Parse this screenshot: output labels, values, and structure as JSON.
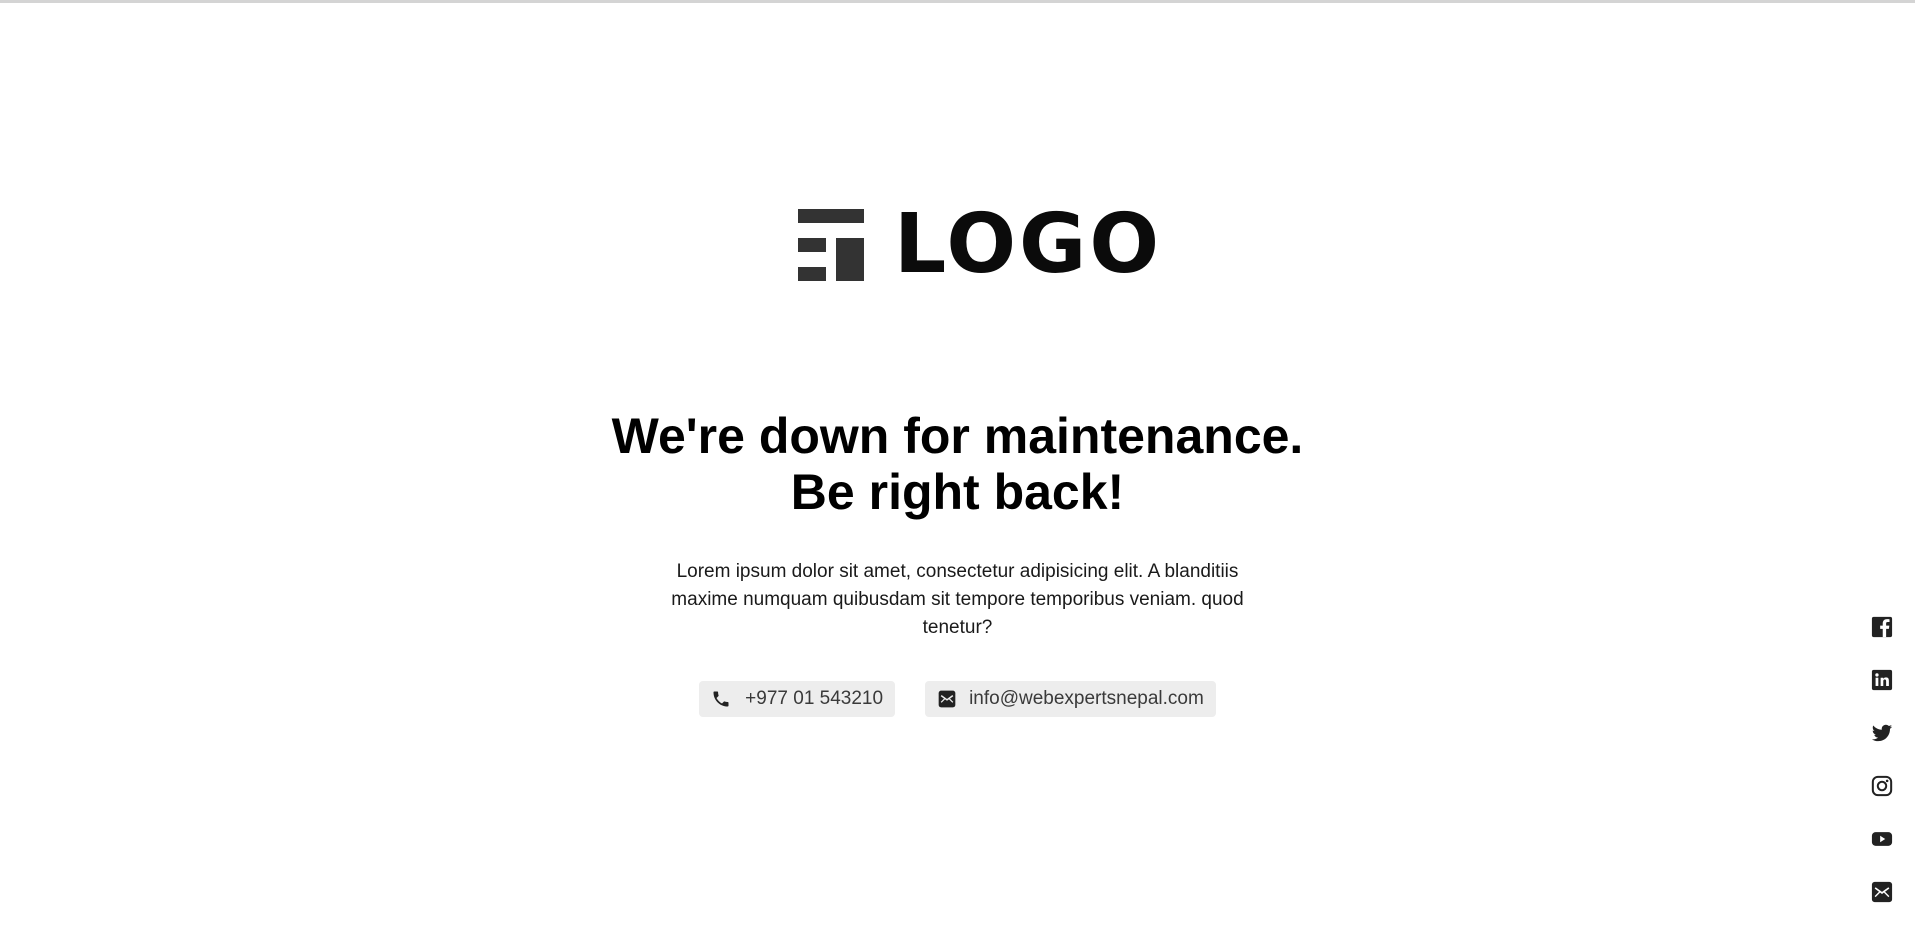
{
  "logo": {
    "text": "LOGO",
    "mark_icon": "brand-mark-icon",
    "color": "#333333"
  },
  "headline": {
    "line1": "We're down for maintenance.",
    "line2": "Be right back!"
  },
  "description": "Lorem ipsum dolor sit amet, consectetur adipisicing elit. A blanditiis maxime numquam quibusdam sit tempore temporibus veniam. quod tenetur?",
  "contacts": {
    "phone": {
      "icon": "phone-icon",
      "label": "+977 01 543210"
    },
    "email": {
      "icon": "mail-icon",
      "label": "info@webexpertsnepal.com"
    }
  },
  "social": [
    {
      "name": "facebook",
      "icon": "facebook-icon"
    },
    {
      "name": "linkedin",
      "icon": "linkedin-icon"
    },
    {
      "name": "twitter",
      "icon": "twitter-icon"
    },
    {
      "name": "instagram",
      "icon": "instagram-icon"
    },
    {
      "name": "youtube",
      "icon": "youtube-icon"
    },
    {
      "name": "email",
      "icon": "mail-icon"
    }
  ],
  "colors": {
    "pill_background": "#ededed",
    "text": "#111111",
    "icon": "#222222"
  }
}
